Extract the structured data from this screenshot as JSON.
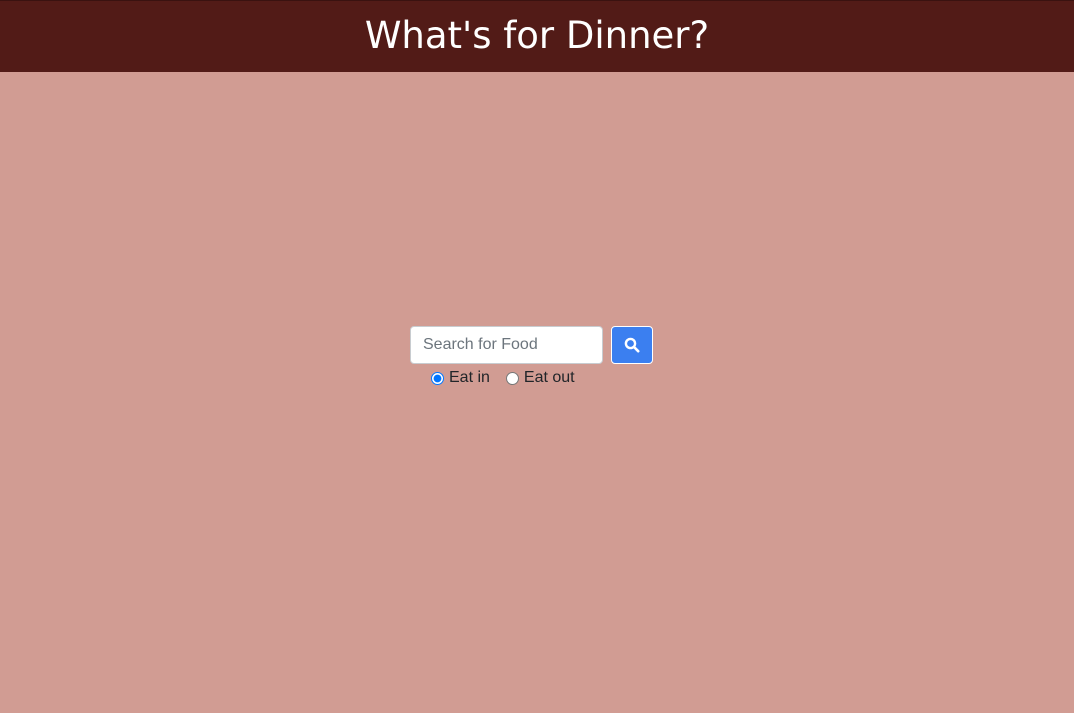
{
  "header": {
    "title": "What's for Dinner?"
  },
  "search": {
    "placeholder": "Search for Food",
    "value": "",
    "button_icon": "search-icon"
  },
  "options": [
    {
      "label": "Eat in",
      "checked": true
    },
    {
      "label": "Eat out",
      "checked": false
    }
  ],
  "colors": {
    "background": "#d19c93",
    "header": "#521b17",
    "button": "#3b7ff0"
  }
}
